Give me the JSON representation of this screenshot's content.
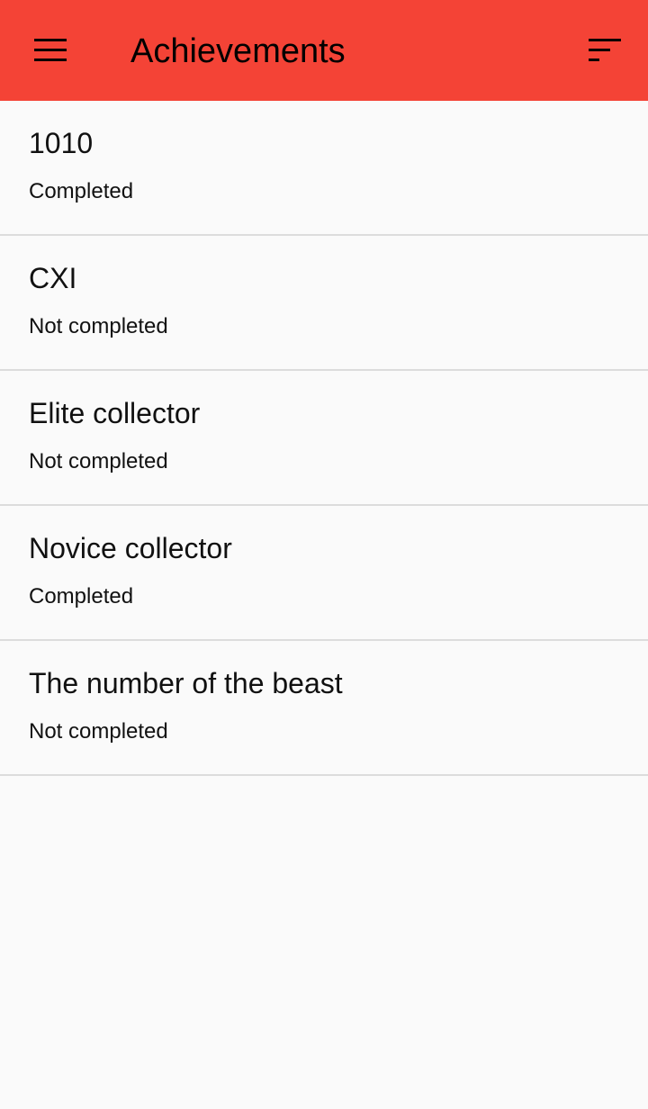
{
  "app_bar": {
    "title": "Achievements",
    "background_color": "#f44336",
    "left_icon": "menu-icon",
    "right_icon": "sort-icon"
  },
  "achievements": [
    {
      "name": "1010",
      "status": "Completed"
    },
    {
      "name": "CXI",
      "status": "Not completed"
    },
    {
      "name": "Elite collector",
      "status": "Not completed"
    },
    {
      "name": "Novice collector",
      "status": "Completed"
    },
    {
      "name": "The number of the beast",
      "status": "Not completed"
    }
  ]
}
